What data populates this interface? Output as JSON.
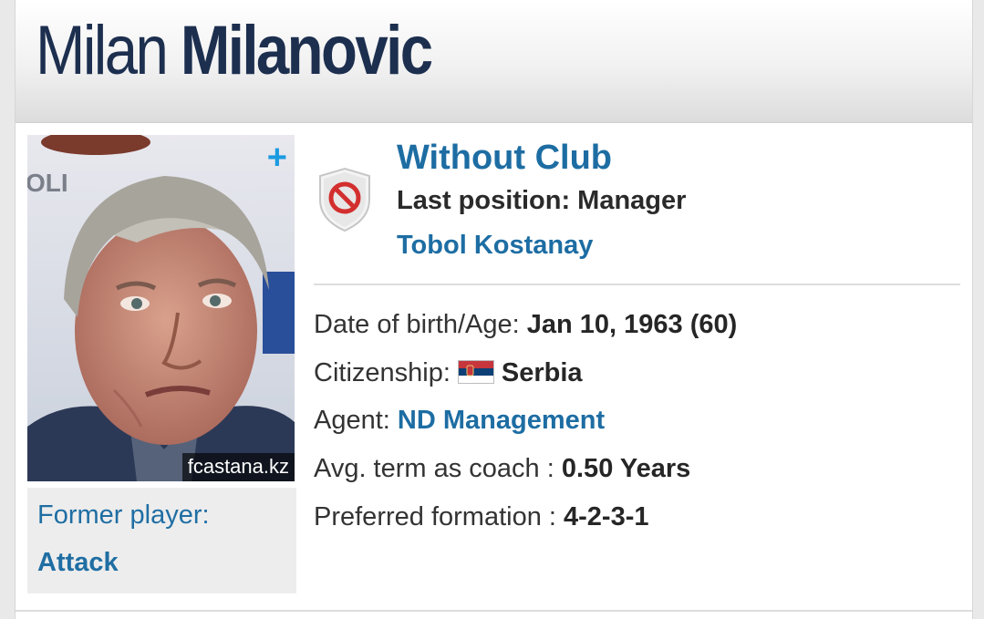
{
  "profile": {
    "first_name": "Milan",
    "last_name": "Milanovic"
  },
  "photo": {
    "credit": "fcastana.kz",
    "add_symbol": "+"
  },
  "former_player": {
    "label": "Former player:",
    "position": "Attack"
  },
  "club": {
    "status": "Without Club",
    "last_position": "Last position: Manager",
    "last_club": "Tobol Kostanay",
    "icon": "no-club-shield-icon"
  },
  "details": {
    "dob_label": "Date of birth/Age:",
    "dob_value": "Jan 10, 1963 (60)",
    "citizenship_label": "Citizenship:",
    "citizenship_value": "Serbia",
    "agent_label": "Agent:",
    "agent_value": "ND Management",
    "avg_term_label": "Avg. term as coach :",
    "avg_term_value": "0.50 Years",
    "formation_label": "Preferred formation :",
    "formation_value": "4-2-3-1"
  },
  "colors": {
    "link": "#1d6da3",
    "title": "#1d2f4f",
    "plus": "#1a9be0"
  }
}
